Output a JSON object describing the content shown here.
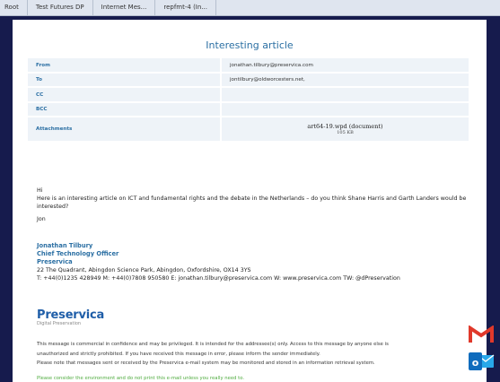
{
  "tabs": [
    "Root",
    "Test Futures DP",
    "Internet Mes...",
    "repfmt-4 (In..."
  ],
  "email": {
    "title": "Interesting article",
    "fields": {
      "from_label": "From",
      "from_value": "jonathan.tilbury@preservica.com",
      "to_label": "To",
      "to_value": "jontilbury@oldworcesters.net,",
      "cc_label": "CC",
      "cc_value": "",
      "bcc_label": "BCC",
      "bcc_value": "",
      "attachments_label": "Attachments",
      "attachment_name": "art64-19.wpd (document)",
      "attachment_size": "105 KB"
    },
    "body": {
      "greeting": "Hi",
      "message": "Here is an interesting article on ICT and fundamental rights and the debate in the Netherlands – do you think Shane Harris and Garth Landers would be interested?",
      "signoff": "Jon"
    },
    "signature": {
      "name": "Jonathan Tilbury",
      "role": "Chief Technology Officer",
      "company": "Preservica",
      "address": "22 The Quadrant, Abingdon Science Park, Abingdon, Oxfordshire, OX14 3YS",
      "contact": "T: +44(0)1235 428949   M: +44(0)7808 950580   E: jonathan.tilbury@preservica.com   W: www.preservica.com   TW: @dPreservation"
    },
    "logo": {
      "name": "Preservica",
      "tagline": "Digital Preservation"
    },
    "disclaimer": [
      "This message is commercial in confidence and may be privileged. It is intended for the addressee(s) only. Access to this message by anyone else is",
      "unauthorized and strictly prohibited. If you have received this message in error, please inform the sender immediately.",
      "Please note that messages sent or received by the Preservica e-mail system may be monitored and stored in an information retrieval system."
    ],
    "environment_note": "Please consider the environment and do not print this e-mail unless you really need to."
  },
  "icons": {
    "gmail": "gmail-icon",
    "outlook": "outlook-icon"
  },
  "colors": {
    "background": "#161b4d",
    "accent": "#2b6fa3",
    "env_green": "#4caa3b",
    "gmail_red": "#e0392b",
    "outlook_blue": "#0f6cbd"
  }
}
